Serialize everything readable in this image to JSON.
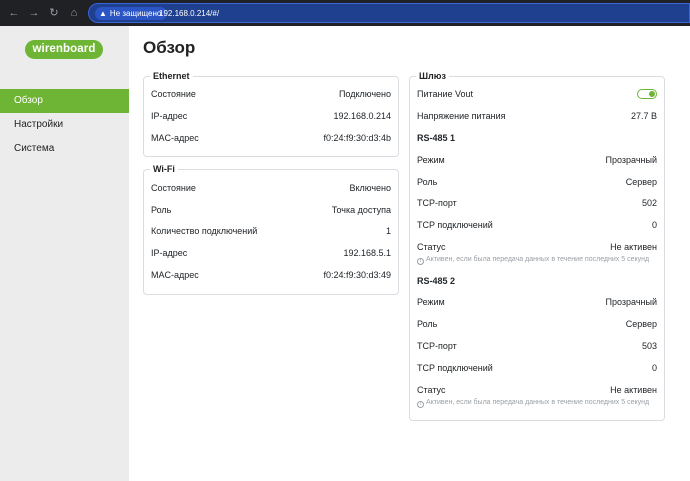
{
  "browser": {
    "security_label": "Не защищено",
    "url": "192.168.0.214/#/"
  },
  "sidebar": {
    "logo": "wirenboard",
    "items": [
      {
        "label": "Обзор",
        "active": true
      },
      {
        "label": "Настройки",
        "active": false
      },
      {
        "label": "Система",
        "active": false
      }
    ]
  },
  "page": {
    "title": "Обзор"
  },
  "ethernet": {
    "legend": "Ethernet",
    "rows": [
      {
        "k": "Состояние",
        "v": "Подключено"
      },
      {
        "k": "IP-адрес",
        "v": "192.168.0.214"
      },
      {
        "k": "MAC-адрес",
        "v": "f0:24:f9:30:d3:4b"
      }
    ]
  },
  "wifi": {
    "legend": "Wi-Fi",
    "rows": [
      {
        "k": "Состояние",
        "v": "Включено"
      },
      {
        "k": "Роль",
        "v": "Точка доступа"
      },
      {
        "k": "Количество подключений",
        "v": "1"
      },
      {
        "k": "IP-адрес",
        "v": "192.168.5.1"
      },
      {
        "k": "MAC-адрес",
        "v": "f0:24:f9:30:d3:49"
      }
    ]
  },
  "gateway": {
    "legend": "Шлюз",
    "power_label": "Питание Vout",
    "power_on": true,
    "voltage_label": "Напряжение питания",
    "voltage_value": "27.7 В",
    "rs1": {
      "title": "RS-485 1",
      "rows": [
        {
          "k": "Режим",
          "v": "Прозрачный"
        },
        {
          "k": "Роль",
          "v": "Сервер"
        },
        {
          "k": "TCP-порт",
          "v": "502"
        },
        {
          "k": "TCP подключений",
          "v": "0"
        },
        {
          "k": "Статус",
          "v": "Не активен"
        }
      ],
      "hint": "Активен, если была передача данных в течение последних 5 секунд"
    },
    "rs2": {
      "title": "RS-485 2",
      "rows": [
        {
          "k": "Режим",
          "v": "Прозрачный"
        },
        {
          "k": "Роль",
          "v": "Сервер"
        },
        {
          "k": "TCP-порт",
          "v": "503"
        },
        {
          "k": "TCP подключений",
          "v": "0"
        },
        {
          "k": "Статус",
          "v": "Не активен"
        }
      ],
      "hint": "Активен, если была передача данных в течение последних 5 секунд"
    }
  },
  "colors": {
    "accent": "#6fb535",
    "sidebar_bg": "#ececec"
  }
}
